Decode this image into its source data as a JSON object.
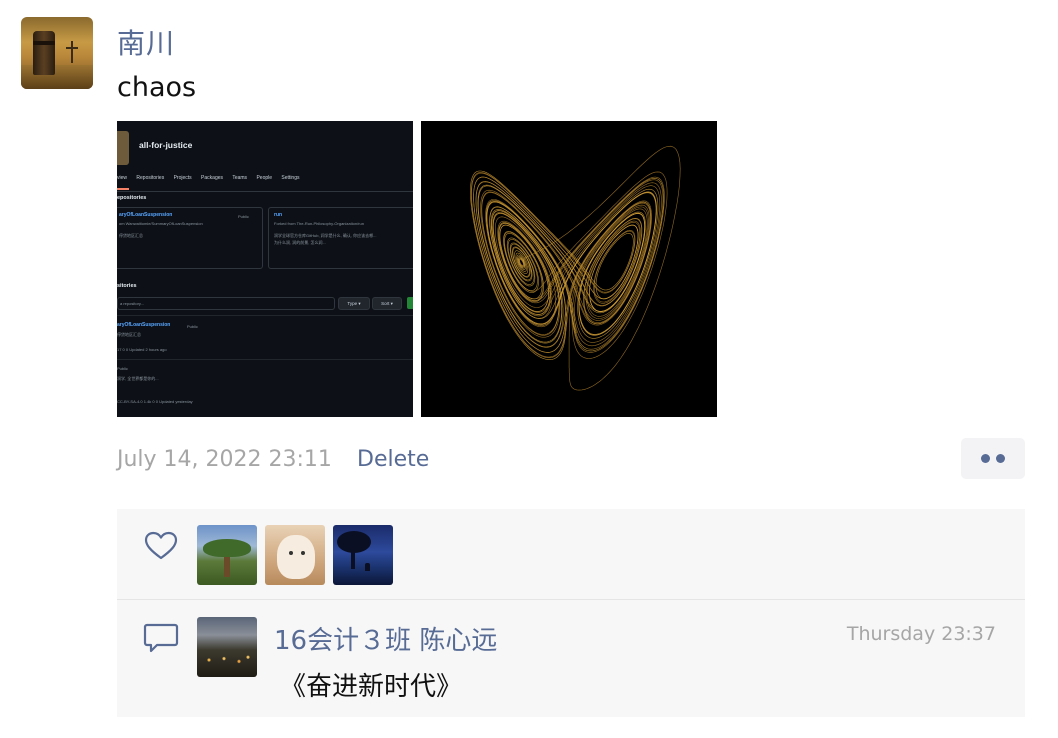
{
  "post": {
    "author": "南川",
    "text": "chaos",
    "timestamp": "July 14, 2022 23:11",
    "delete_label": "Delete"
  },
  "image_github": {
    "org": "all-for-justice",
    "nav": [
      "view",
      "Repositories",
      "Projects",
      "Packages",
      "Teams",
      "People",
      "Settings"
    ],
    "repos_heading": "epositories",
    "card1": {
      "title": "aryOfLoanSuspension",
      "badge": "Public",
      "line1": "om Wanwaitiomie/SummaryOfLoanSuspension",
      "line2": "停贷地区汇总"
    },
    "card2": {
      "title": "run",
      "line1": "Forked from The-Run-Philosophy-Organization/run",
      "line2": "润学全球官方仓库GitHub, 润学是什么, 确认, 你应该去哪...",
      "line3": "为什么润, 润的前景, 怎么润..."
    },
    "list_heading": "sitories",
    "search_placeholder": "a repository...",
    "type_label": "Type",
    "sort_label": "Sort",
    "row1": {
      "title": "aryOfLoanSuspension",
      "badge": "Public",
      "desc": "停贷地区汇总",
      "meta": "17  0  0  Updated 2 hours ago"
    },
    "row2": {
      "badge": "Public",
      "desc": "润学, 全世界都是你的...",
      "meta": "CC-BY-SA-4.0  1.4k  0  0  Updated yesterday"
    }
  },
  "likes": {
    "icon": "heart-icon",
    "avatars": [
      "dragon-tree-avatar",
      "puppy-avatar",
      "night-tree-avatar"
    ]
  },
  "comment": {
    "icon": "comment-icon",
    "name": "16会计３班 陈心远",
    "time": "Thursday 23:37",
    "text": "《奋进新时代》"
  },
  "colors": {
    "link": "#576b95",
    "muted": "#a6a6a6",
    "panel": "#f7f7f7"
  }
}
